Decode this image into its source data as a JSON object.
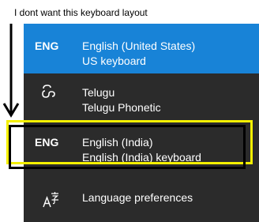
{
  "annotation": {
    "text": "I dont want this keyboard layout",
    "arrow_color": "#000000",
    "highlight_colors": [
      "#f5f000",
      "#000000"
    ]
  },
  "flyout": {
    "background": "#2b2b2b",
    "selected_background": "#1883d7",
    "items": [
      {
        "abbr": "ENG",
        "name": "English (United States)",
        "keyboard": "US keyboard",
        "selected": true
      },
      {
        "abbr": "",
        "icon": "telugu-script-icon",
        "name": "Telugu",
        "keyboard": "Telugu Phonetic",
        "selected": false
      },
      {
        "abbr": "ENG",
        "name": "English (India)",
        "keyboard": "English (India) keyboard",
        "selected": false
      }
    ],
    "preferences": {
      "icon": "language-icon",
      "label": "Language preferences"
    }
  }
}
